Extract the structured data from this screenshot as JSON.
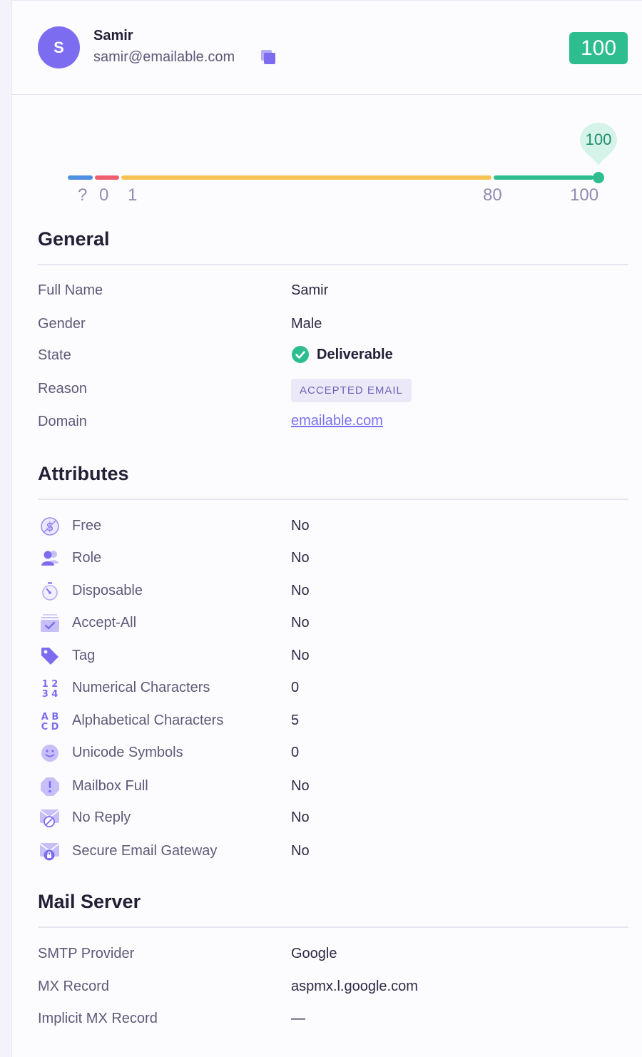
{
  "header": {
    "avatar_initial": "S",
    "name": "Samir",
    "email": "samir@emailable.com",
    "score": "100"
  },
  "scale": {
    "ticks": [
      "?",
      "0",
      "1",
      "80",
      "100"
    ],
    "marker_value": "100",
    "score_fraction": 1.0,
    "colors": {
      "unknown": "#4e8fe0",
      "undeliverable": "#ef5f70",
      "risky": "#f6c253",
      "deliverable": "#2dbd8f"
    }
  },
  "general": {
    "title": "General",
    "full_name_label": "Full Name",
    "full_name": "Samir",
    "gender_label": "Gender",
    "gender": "Male",
    "state_label": "State",
    "state": "Deliverable",
    "reason_label": "Reason",
    "reason": "ACCEPTED EMAIL",
    "domain_label": "Domain",
    "domain": "emailable.com"
  },
  "attributes": {
    "title": "Attributes",
    "items": [
      {
        "label": "Free",
        "value": "No",
        "icon": "dollar-icon"
      },
      {
        "label": "Role",
        "value": "No",
        "icon": "users-icon"
      },
      {
        "label": "Disposable",
        "value": "No",
        "icon": "stopwatch-icon"
      },
      {
        "label": "Accept-All",
        "value": "No",
        "icon": "inbox-check-icon"
      },
      {
        "label": "Tag",
        "value": "No",
        "icon": "tag-icon"
      },
      {
        "label": "Numerical Characters",
        "value": "0",
        "icon": "numbers-icon"
      },
      {
        "label": "Alphabetical Characters",
        "value": "5",
        "icon": "letters-icon"
      },
      {
        "label": "Unicode Symbols",
        "value": "0",
        "icon": "smiley-icon"
      },
      {
        "label": "Mailbox Full",
        "value": "No",
        "icon": "alert-octagon-icon"
      },
      {
        "label": "No Reply",
        "value": "No",
        "icon": "mail-blocked-icon"
      },
      {
        "label": "Secure Email Gateway",
        "value": "No",
        "icon": "mail-lock-icon"
      }
    ],
    "numbers_glyph": "1 2\n3 4",
    "letters_glyph": "A B\nC D"
  },
  "mail_server": {
    "title": "Mail Server",
    "smtp_label": "SMTP Provider",
    "smtp": "Google",
    "mx_label": "MX Record",
    "mx": "aspmx.l.google.com",
    "implicit_label": "Implicit MX Record",
    "implicit": "—"
  },
  "colors": {
    "accent": "#7c6cf0",
    "success": "#2dbd8f"
  }
}
